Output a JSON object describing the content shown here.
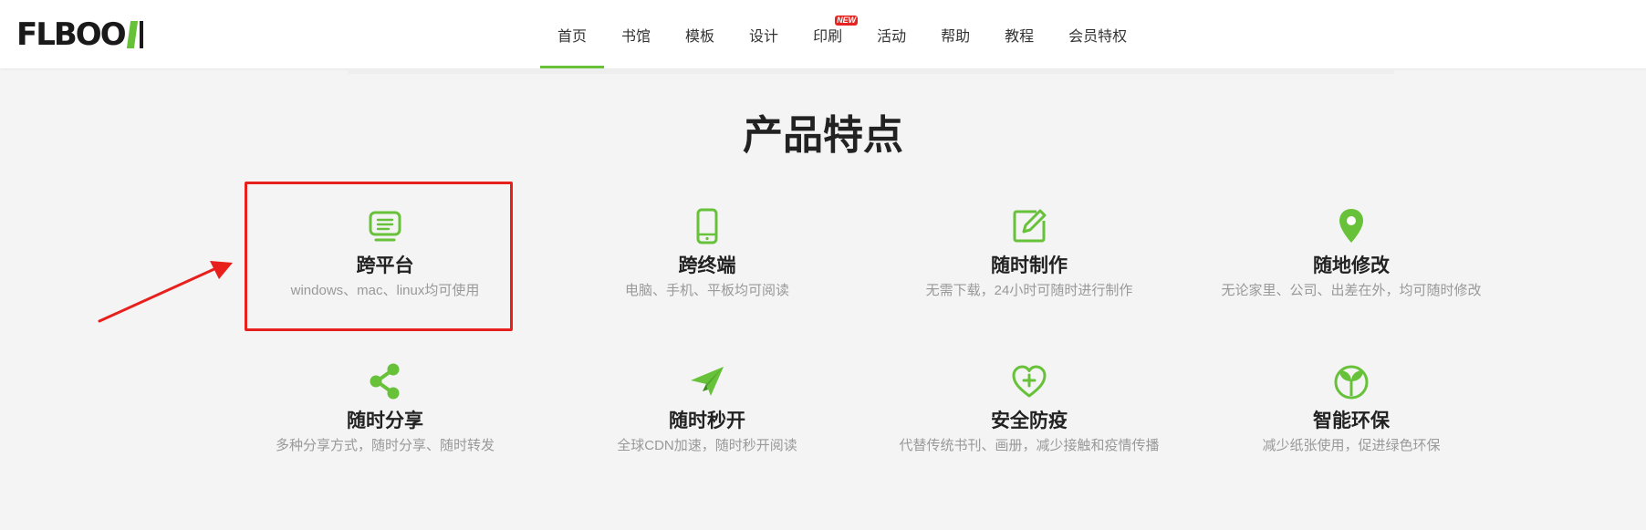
{
  "header": {
    "logo": {
      "text": "FLBOOK"
    },
    "nav": [
      {
        "label": "首页",
        "active": true
      },
      {
        "label": "书馆"
      },
      {
        "label": "模板"
      },
      {
        "label": "设计"
      },
      {
        "label": "印刷",
        "badge": "NEW"
      },
      {
        "label": "活动"
      },
      {
        "label": "帮助"
      },
      {
        "label": "教程"
      },
      {
        "label": "会员特权"
      }
    ]
  },
  "main": {
    "section_title": "产品特点",
    "features": [
      {
        "icon": "monitor-icon",
        "title": "跨平台",
        "desc": "windows、mac、linux均可使用"
      },
      {
        "icon": "mobile-phone-icon",
        "title": "跨终端",
        "desc": "电脑、手机、平板均可阅读"
      },
      {
        "icon": "edit-pen-icon",
        "title": "随时制作",
        "desc": "无需下载，24小时可随时进行制作"
      },
      {
        "icon": "location-pin-icon",
        "title": "随地修改",
        "desc": "无论家里、公司、出差在外，均可随时修改"
      },
      {
        "icon": "share-icon",
        "title": "随时分享",
        "desc": "多种分享方式，随时分享、随时转发"
      },
      {
        "icon": "paper-plane-icon",
        "title": "随时秒开",
        "desc": "全球CDN加速，随时秒开阅读"
      },
      {
        "icon": "heart-plus-icon",
        "title": "安全防疫",
        "desc": "代替传统书刊、画册，减少接触和疫情传播"
      },
      {
        "icon": "leaf-sprout-icon",
        "title": "智能环保",
        "desc": "减少纸张使用，促进绿色环保"
      }
    ]
  },
  "colors": {
    "accent": "#67c23a",
    "highlight": "#e8201d",
    "badge": "#e52421"
  }
}
